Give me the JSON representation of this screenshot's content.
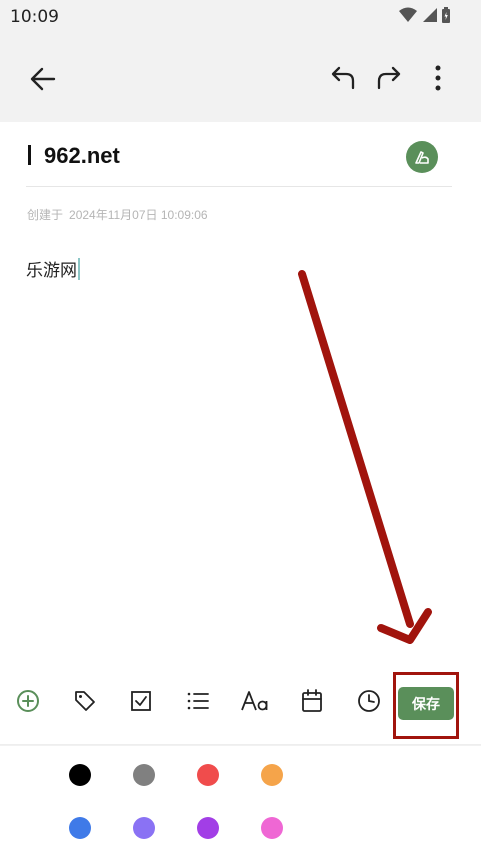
{
  "status_bar": {
    "time": "10:09"
  },
  "note": {
    "title": "962.net",
    "created_label": "创建于",
    "created_time": "2024年11月07日 10:09:06",
    "body": "乐游网"
  },
  "toolbar": {
    "tools": [
      "add-icon",
      "tag-icon",
      "checkbox-icon",
      "list-icon",
      "text-format-icon",
      "calendar-icon",
      "clock-icon"
    ],
    "save_label": "保存"
  },
  "palette": {
    "colors": [
      "#000000",
      "#808080",
      "#f04c4c",
      "#f5a44a",
      "#3f7ae8",
      "#8a72f4",
      "#a23ee6",
      "#ef67d4"
    ]
  },
  "colors": {
    "accent": "#5a8f5a",
    "annotation": "#a1140d"
  }
}
